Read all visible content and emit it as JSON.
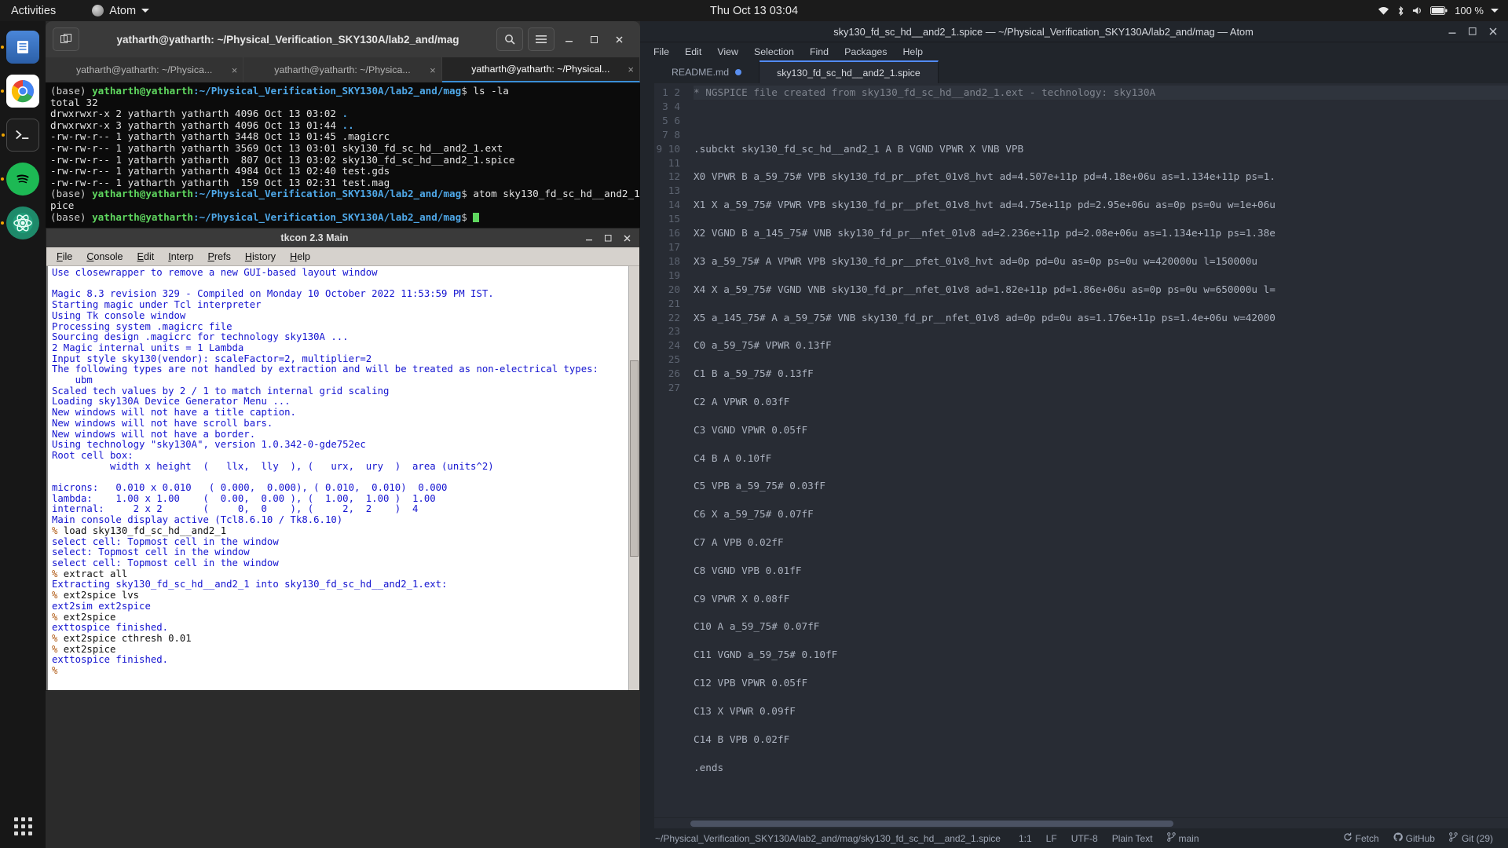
{
  "topbar": {
    "activities": "Activities",
    "app_name": "Atom",
    "clock": "Thu Oct 13  03:04",
    "battery": "100 %",
    "icons": [
      "wifi-icon",
      "bluetooth-icon",
      "volume-icon",
      "battery-icon",
      "power-chevron-icon"
    ]
  },
  "dock": {
    "items": [
      {
        "name": "files-icon",
        "color": "#2b6ec6",
        "running": true
      },
      {
        "name": "chrome-icon",
        "color": "#ffffff",
        "running": true
      },
      {
        "name": "terminal-icon",
        "color": "#2a2a2a",
        "running": true
      },
      {
        "name": "spotify-icon",
        "color": "#1db954",
        "running": true
      },
      {
        "name": "atom-icon",
        "color": "#1e8a6a",
        "running": true
      }
    ],
    "show_apps": "show-applications"
  },
  "terminal": {
    "title": "yatharth@yatharth: ~/Physical_Verification_SKY130A/lab2_and/mag",
    "toolbar": {
      "new_tab": "new-tab-icon",
      "search": "search-icon",
      "menu": "hamburger-menu-icon",
      "minimize": "minimize",
      "maximize": "maximize",
      "close": "close"
    },
    "tabs": [
      {
        "label": "yatharth@yatharth: ~/Physica...",
        "active": false
      },
      {
        "label": "yatharth@yatharth: ~/Physica...",
        "active": false
      },
      {
        "label": "yatharth@yatharth: ~/Physical...",
        "active": true
      }
    ],
    "prompt_env": "(base)",
    "prompt_user": "yatharth@yatharth",
    "prompt_path": ":~/Physical_Verification_SKY130A/lab2_and/mag",
    "prompt_sym": "$ ",
    "cmd1": "ls -la",
    "listing_total": "total 32",
    "listing": [
      {
        "perm": "drwxrwxr-x",
        "links": "2",
        "user": "yatharth",
        "group": "yatharth",
        "size": "4096",
        "date": "Oct 13 03:02",
        "name": ".",
        "isdir": true
      },
      {
        "perm": "drwxrwxr-x",
        "links": "3",
        "user": "yatharth",
        "group": "yatharth",
        "size": "4096",
        "date": "Oct 13 01:44",
        "name": "..",
        "isdir": true
      },
      {
        "perm": "-rw-rw-r--",
        "links": "1",
        "user": "yatharth",
        "group": "yatharth",
        "size": "3448",
        "date": "Oct 13 01:45",
        "name": ".magicrc",
        "isdir": false
      },
      {
        "perm": "-rw-rw-r--",
        "links": "1",
        "user": "yatharth",
        "group": "yatharth",
        "size": "3569",
        "date": "Oct 13 03:01",
        "name": "sky130_fd_sc_hd__and2_1.ext",
        "isdir": false
      },
      {
        "perm": "-rw-rw-r--",
        "links": "1",
        "user": "yatharth",
        "group": "yatharth",
        "size": " 807",
        "date": "Oct 13 03:02",
        "name": "sky130_fd_sc_hd__and2_1.spice",
        "isdir": false
      },
      {
        "perm": "-rw-rw-r--",
        "links": "1",
        "user": "yatharth",
        "group": "yatharth",
        "size": "4984",
        "date": "Oct 13 02:40",
        "name": "test.gds",
        "isdir": false
      },
      {
        "perm": "-rw-rw-r--",
        "links": "1",
        "user": "yatharth",
        "group": "yatharth",
        "size": " 159",
        "date": "Oct 13 02:31",
        "name": "test.mag",
        "isdir": false
      }
    ],
    "cmd2": "atom sky130_fd_sc_hd__and2_1.s",
    "cmd2_wrap": "pice"
  },
  "tkcon": {
    "title": "tkcon 2.3 Main",
    "window_buttons": [
      "minimize",
      "maximize",
      "close"
    ],
    "menu": [
      "File",
      "Console",
      "Edit",
      "Interp",
      "Prefs",
      "History",
      "Help"
    ],
    "lines": [
      {
        "t": "Use closewrapper to remove a new GUI-based layout window",
        "k": "b"
      },
      {
        "t": "",
        "k": "b"
      },
      {
        "t": "Magic 8.3 revision 329 - Compiled on Monday 10 October 2022 11:53:59 PM IST.",
        "k": "b"
      },
      {
        "t": "Starting magic under Tcl interpreter",
        "k": "b"
      },
      {
        "t": "Using Tk console window",
        "k": "b"
      },
      {
        "t": "Processing system .magicrc file",
        "k": "b"
      },
      {
        "t": "Sourcing design .magicrc for technology sky130A ...",
        "k": "b"
      },
      {
        "t": "2 Magic internal units = 1 Lambda",
        "k": "b"
      },
      {
        "t": "Input style sky130(vendor): scaleFactor=2, multiplier=2",
        "k": "b"
      },
      {
        "t": "The following types are not handled by extraction and will be treated as non-electrical types:",
        "k": "b"
      },
      {
        "t": "    ubm",
        "k": "b"
      },
      {
        "t": "Scaled tech values by 2 / 1 to match internal grid scaling",
        "k": "b"
      },
      {
        "t": "Loading sky130A Device Generator Menu ...",
        "k": "b"
      },
      {
        "t": "New windows will not have a title caption.",
        "k": "b"
      },
      {
        "t": "New windows will not have scroll bars.",
        "k": "b"
      },
      {
        "t": "New windows will not have a border.",
        "k": "b"
      },
      {
        "t": "Using technology \"sky130A\", version 1.0.342-0-gde752ec",
        "k": "b"
      },
      {
        "t": "Root cell box:",
        "k": "b"
      },
      {
        "t": "          width x height  (   llx,  lly  ), (   urx,  ury  )  area (units^2)",
        "k": "b"
      },
      {
        "t": "",
        "k": "b"
      },
      {
        "t": "microns:   0.010 x 0.010   ( 0.000,  0.000), ( 0.010,  0.010)  0.000",
        "k": "b"
      },
      {
        "t": "lambda:    1.00 x 1.00    (  0.00,  0.00 ), (  1.00,  1.00 )  1.00",
        "k": "b"
      },
      {
        "t": "internal:     2 x 2       (     0,  0    ), (     2,  2    )  4",
        "k": "b"
      },
      {
        "t": "Main console display active (Tcl8.6.10 / Tk8.6.10)",
        "k": "b"
      },
      {
        "t": "% load sky130_fd_sc_hd__and2_1",
        "k": "p"
      },
      {
        "t": "select cell: Topmost cell in the window",
        "k": "b"
      },
      {
        "t": "select: Topmost cell in the window",
        "k": "b"
      },
      {
        "t": "select cell: Topmost cell in the window",
        "k": "b"
      },
      {
        "t": "% extract all",
        "k": "p"
      },
      {
        "t": "Extracting sky130_fd_sc_hd__and2_1 into sky130_fd_sc_hd__and2_1.ext:",
        "k": "b"
      },
      {
        "t": "% ext2spice lvs",
        "k": "p"
      },
      {
        "t": "ext2sim ext2spice",
        "k": "b"
      },
      {
        "t": "% ext2spice",
        "k": "p"
      },
      {
        "t": "exttospice finished.",
        "k": "b"
      },
      {
        "t": "% ext2spice cthresh 0.01",
        "k": "p"
      },
      {
        "t": "% ext2spice",
        "k": "p"
      },
      {
        "t": "exttospice finished.",
        "k": "b"
      },
      {
        "t": "%",
        "k": "p"
      }
    ]
  },
  "atom": {
    "title": "sky130_fd_sc_hd__and2_1.spice — ~/Physical_Verification_SKY130A/lab2_and/mag — Atom",
    "window_buttons": [
      "minimize",
      "maximize",
      "close"
    ],
    "menu": [
      "File",
      "Edit",
      "View",
      "Selection",
      "Find",
      "Packages",
      "Help"
    ],
    "tabs": [
      {
        "label": "README.md",
        "active": false,
        "modified": true
      },
      {
        "label": "sky130_fd_sc_hd__and2_1.spice",
        "active": true,
        "modified": false
      }
    ],
    "code_lines": [
      "* NGSPICE file created from sky130_fd_sc_hd__and2_1.ext - technology: sky130A",
      "",
      ".subckt sky130_fd_sc_hd__and2_1 A B VGND VPWR X VNB VPB",
      "X0 VPWR B a_59_75# VPB sky130_fd_pr__pfet_01v8_hvt ad=4.507e+11p pd=4.18e+06u as=1.134e+11p ps=1.",
      "X1 X a_59_75# VPWR VPB sky130_fd_pr__pfet_01v8_hvt ad=4.75e+11p pd=2.95e+06u as=0p ps=0u w=1e+06u",
      "X2 VGND B a_145_75# VNB sky130_fd_pr__nfet_01v8 ad=2.236e+11p pd=2.08e+06u as=1.134e+11p ps=1.38e",
      "X3 a_59_75# A VPWR VPB sky130_fd_pr__pfet_01v8_hvt ad=0p pd=0u as=0p ps=0u w=420000u l=150000u",
      "X4 X a_59_75# VGND VNB sky130_fd_pr__nfet_01v8 ad=1.82e+11p pd=1.86e+06u as=0p ps=0u w=650000u l=",
      "X5 a_145_75# A a_59_75# VNB sky130_fd_pr__nfet_01v8 ad=0p pd=0u as=1.176e+11p ps=1.4e+06u w=42000",
      "C0 a_59_75# VPWR 0.13fF",
      "C1 B a_59_75# 0.13fF",
      "C2 A VPWR 0.03fF",
      "C3 VGND VPWR 0.05fF",
      "C4 B A 0.10fF",
      "C5 VPB a_59_75# 0.03fF",
      "C6 X a_59_75# 0.07fF",
      "C7 A VPB 0.02fF",
      "C8 VGND VPB 0.01fF",
      "C9 VPWR X 0.08fF",
      "C10 A a_59_75# 0.07fF",
      "C11 VGND a_59_75# 0.10fF",
      "C12 VPB VPWR 0.05fF",
      "C13 X VPWR 0.09fF",
      "C14 B VPB 0.02fF",
      ".ends",
      "",
      ""
    ],
    "status": {
      "path": "~/Physical_Verification_SKY130A/lab2_and/mag/sky130_fd_sc_hd__and2_1.spice",
      "cursor": "1:1",
      "line_ending": "LF",
      "encoding": "UTF-8",
      "grammar": "Plain Text",
      "branch": "main",
      "fetch": "Fetch",
      "github": "GitHub",
      "git": "Git (29)"
    }
  }
}
